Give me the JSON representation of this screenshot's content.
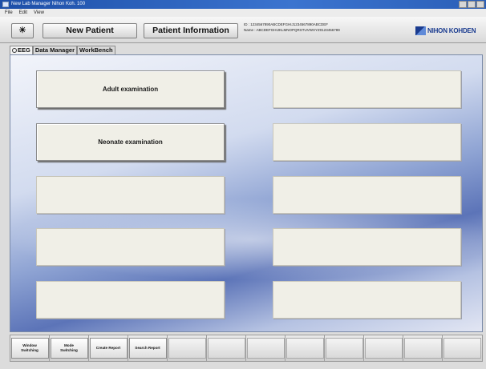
{
  "window": {
    "title": "New Lab Manager Nihon Koh. 100"
  },
  "menu": [
    "File",
    "Edit",
    "View"
  ],
  "toolbar": {
    "icon_button": "☀",
    "new_patient": "New Patient",
    "patient_information": "Patient Information",
    "patient_id_line": "ID : 1234567890ABCDEFGHIJ1234567890ABCDEF",
    "patient_name_line": "Name : ABCDEFGHIJKLMNOPQRSTUVWXYZ0123456789",
    "logo_text": "NIHON KOHDEN"
  },
  "tabs": {
    "eeg": "EEG",
    "data_manager": "Data Manager",
    "workbench": "WorkBench"
  },
  "exam_buttons": {
    "adult": "Adult examination",
    "neonate": "Neonate examination"
  },
  "function_keys": [
    "Window\nSwitching",
    "Mode\nSwitching",
    "Create Report",
    "Search Report",
    "",
    "",
    "",
    "",
    "",
    "",
    "",
    ""
  ],
  "colors": {
    "title_bar": "#2b5fb8",
    "panel_button": "#f0efe7",
    "logo": "#1a3b8f"
  }
}
